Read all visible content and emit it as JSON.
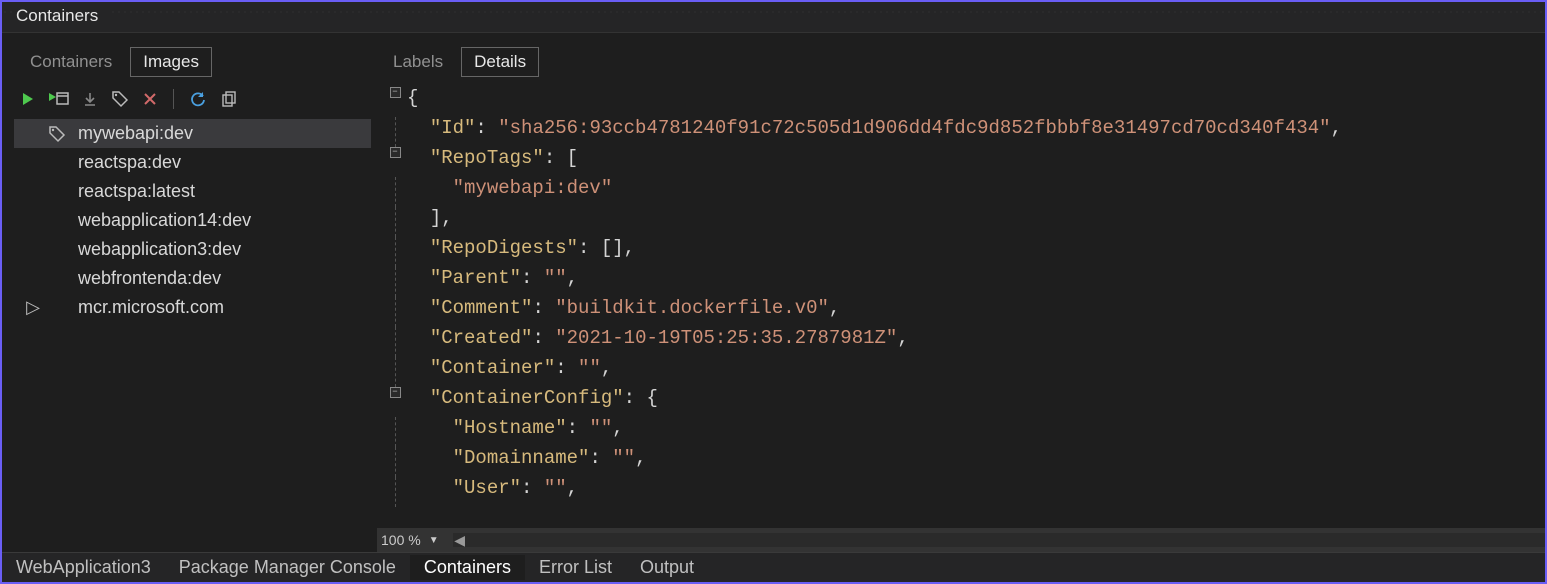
{
  "window": {
    "title": "Containers"
  },
  "sidebar": {
    "tabs": [
      {
        "label": "Containers",
        "active": false
      },
      {
        "label": "Images",
        "active": true
      }
    ],
    "items": [
      {
        "label": "mywebapi:dev",
        "selected": true,
        "tagged": true,
        "expander": ""
      },
      {
        "label": "reactspa:dev",
        "selected": false,
        "tagged": false,
        "expander": ""
      },
      {
        "label": "reactspa:latest",
        "selected": false,
        "tagged": false,
        "expander": ""
      },
      {
        "label": "webapplication14:dev",
        "selected": false,
        "tagged": false,
        "expander": ""
      },
      {
        "label": "webapplication3:dev",
        "selected": false,
        "tagged": false,
        "expander": ""
      },
      {
        "label": "webfrontenda:dev",
        "selected": false,
        "tagged": false,
        "expander": ""
      },
      {
        "label": "mcr.microsoft.com",
        "selected": false,
        "tagged": false,
        "expander": "▷"
      }
    ]
  },
  "main": {
    "tabs": [
      {
        "label": "Labels",
        "active": false
      },
      {
        "label": "Details",
        "active": true
      }
    ],
    "zoom": "100 %"
  },
  "json_details": {
    "Id": "sha256:93ccb4781240f91c72c505d1d906dd4fdc9d852fbbbf8e31497cd70cd340f434",
    "RepoTags": [
      "mywebapi:dev"
    ],
    "RepoDigests": [],
    "Parent": "",
    "Comment": "buildkit.dockerfile.v0",
    "Created": "2021-10-19T05:25:35.2787981Z",
    "Container": "",
    "ContainerConfig": {
      "Hostname": "",
      "Domainname": "",
      "User": ""
    }
  },
  "bottom_tabs": [
    {
      "label": "WebApplication3",
      "active": false
    },
    {
      "label": "Package Manager Console",
      "active": false
    },
    {
      "label": "Containers",
      "active": true
    },
    {
      "label": "Error List",
      "active": false
    },
    {
      "label": "Output",
      "active": false
    }
  ]
}
